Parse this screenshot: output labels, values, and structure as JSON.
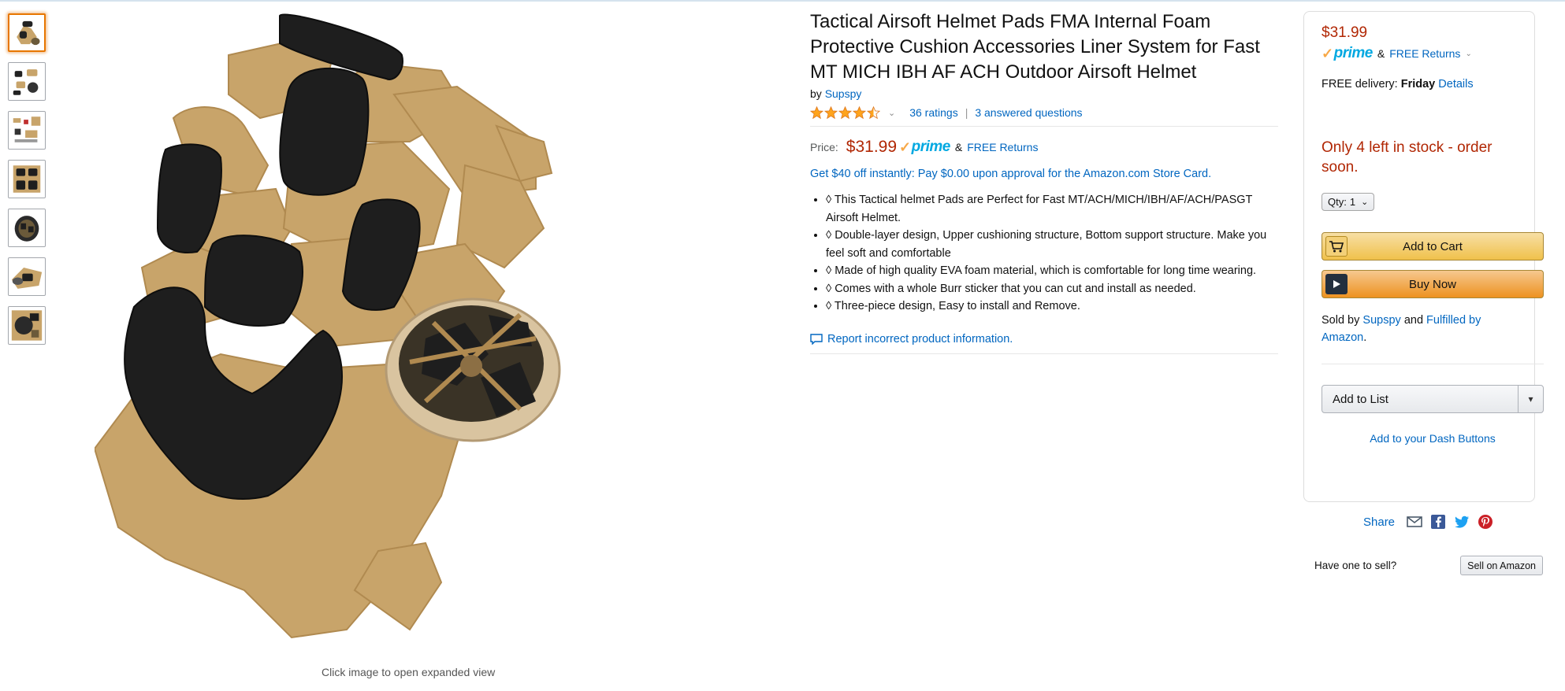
{
  "gallery": {
    "thumbnail_count": 7,
    "active_index": 0,
    "caption": "Click image to open expanded view"
  },
  "product": {
    "title": "Tactical Airsoft Helmet Pads FMA Internal Foam Protective Cushion Accessories Liner System for Fast MT MICH IBH AF ACH Outdoor Airsoft Helmet",
    "by_label": "by",
    "brand": "Supspy",
    "rating_stars": 4.5,
    "ratings_text": "36 ratings",
    "separator": "|",
    "questions_text": "3 answered questions",
    "price_label": "Price:",
    "price": "$31.99",
    "prime_label": "prime",
    "amp": "&",
    "free_returns": "FREE Returns",
    "promo": "Get $40 off instantly: Pay $0.00 upon approval for the Amazon.com Store Card.",
    "bullets": [
      "◊ This Tactical helmet Pads are Perfect for Fast MT/ACH/MICH/IBH/AF/ACH/PASGT Airsoft Helmet.",
      "◊ Double-layer design, Upper cushioning structure, Bottom support structure. Make you feel soft and comfortable",
      "◊ Made of high quality EVA foam material, which is comfortable for long time wearing.",
      "◊ Comes with a whole Burr sticker that you can cut and install as needed.",
      "◊ Three-piece design, Easy to install and Remove."
    ],
    "report_link": "Report incorrect product information."
  },
  "buybox": {
    "price": "$31.99",
    "prime_label": "prime",
    "amp": "&",
    "free_returns": "FREE Returns",
    "delivery_prefix": "FREE delivery:",
    "delivery_day": "Friday",
    "details_link": "Details",
    "stock_text": "Only 4 left in stock - order soon.",
    "qty_label": "Qty:",
    "qty_value": "1",
    "add_to_cart": "Add to Cart",
    "buy_now": "Buy Now",
    "sold_by_prefix": "Sold by",
    "seller": "Supspy",
    "sold_and": "and",
    "fulfilled_by": "Fulfilled by Amazon",
    "sold_end": ".",
    "add_to_list": "Add to List",
    "dash_buttons": "Add to your Dash Buttons"
  },
  "share": {
    "label": "Share",
    "icons": [
      "email-icon",
      "facebook-icon",
      "twitter-icon",
      "pinterest-icon"
    ]
  },
  "sell": {
    "question": "Have one to sell?",
    "button": "Sell on Amazon"
  },
  "colors": {
    "link": "#0066c0",
    "price": "#b12704",
    "prime": "#00a8e1",
    "cart_button": "#f0c14b",
    "buy_button": "#ed9220",
    "foam_tan": "#c8a46a",
    "pad_black": "#1e1e1e"
  }
}
